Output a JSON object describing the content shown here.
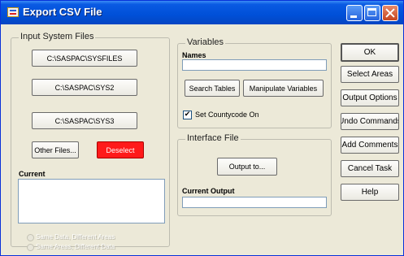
{
  "window": {
    "title": "Export CSV File"
  },
  "input_group": {
    "legend": "Input System Files",
    "files": [
      "C:\\SASPAC\\SYSFILES",
      "C:\\SASPAC\\SYS2",
      "C:\\SASPAC\\SYS3"
    ],
    "other_label": "Other Files...",
    "deselect_label": "Deselect",
    "current_label": "Current",
    "radio1": "Same Data, Different Areas",
    "radio2": "Same Areas, Different Data"
  },
  "variables_group": {
    "legend": "Variables",
    "names_label": "Names",
    "search_label": "Search Tables",
    "manipulate_label": "Manipulate Variables",
    "countycode_label": "Set Countycode On",
    "countycode_checked": "✔"
  },
  "interface_group": {
    "legend": "Interface File",
    "output_to_label": "Output to...",
    "current_output_label": "Current Output"
  },
  "side_buttons": {
    "ok": "OK",
    "select_areas": "Select Areas",
    "output_options": "Output Options",
    "undo_commands": "Undo Commands",
    "add_comments": "Add Comments",
    "cancel_task": "Cancel Task",
    "help": "Help"
  }
}
